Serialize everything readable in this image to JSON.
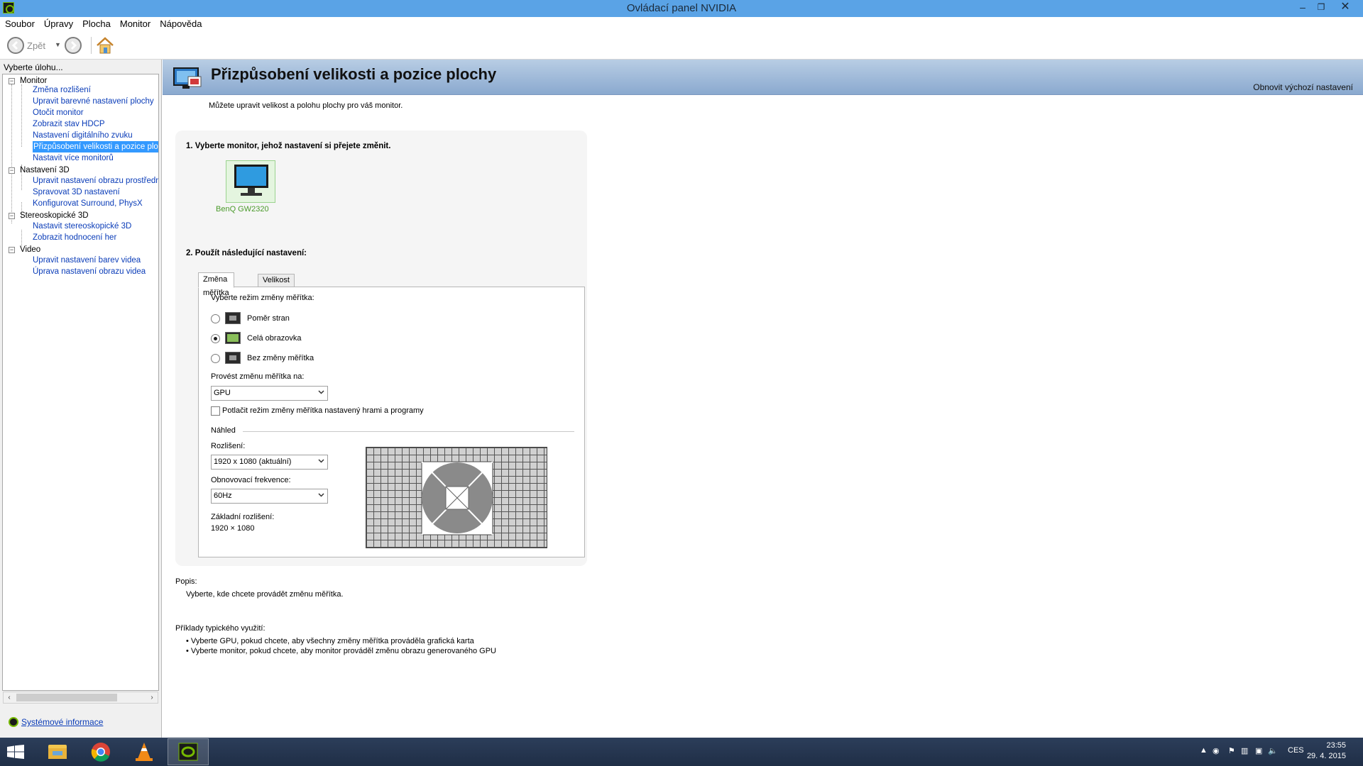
{
  "window": {
    "title": "Ovládací panel NVIDIA"
  },
  "menu": [
    "Soubor",
    "Úpravy",
    "Plocha",
    "Monitor",
    "Nápověda"
  ],
  "toolbar": {
    "back_label": "Zpět"
  },
  "left": {
    "header": "Vyberte úlohu...",
    "tree": {
      "monitor": "Monitor",
      "monitor_items": [
        "Změna rozlišení",
        "Upravit barevné nastavení plochy",
        "Otočit monitor",
        "Zobrazit stav HDCP",
        "Nastavení digitálního zvuku",
        "Přizpůsobení velikosti a pozice plochy",
        "Nastavit více monitorů"
      ],
      "settings3d": "Nastavení 3D",
      "settings3d_items": [
        "Upravit nastavení obrazu prostřednic",
        "Spravovat 3D nastavení",
        "Konfigurovat Surround, PhysX"
      ],
      "stereo": "Stereoskopické 3D",
      "stereo_items": [
        "Nastavit stereoskopické 3D",
        "Zobrazit hodnocení her"
      ],
      "video": "Video",
      "video_items": [
        "Upravit nastavení barev videa",
        "Úprava nastavení obrazu videa"
      ]
    },
    "sysinfo": "Systémové informace"
  },
  "page": {
    "heading": "Přizpůsobení velikosti a pozice plochy",
    "restore": "Obnovit výchozí nastavení",
    "intro": "Můžete upravit velikost a polohu plochy pro váš monitor.",
    "step1": "1. Vyberte monitor, jehož nastavení si přejete změnit.",
    "monitor_name": "BenQ GW2320",
    "step2": "2. Použít následující nastavení:",
    "tabs": [
      "Změna měřítka",
      "Velikost"
    ],
    "scaling_mode_label": "Vyberte režim změny měřítka:",
    "modes": [
      "Poměr stran",
      "Celá obrazovka",
      "Bez změny měřítka"
    ],
    "selected_mode": "Celá obrazovka",
    "perform_on_label": "Provést změnu měřítka na:",
    "perform_on_value": "GPU",
    "override_label": "Potlačit režim změny měřítka nastavený hrami a programy",
    "override_checked": false,
    "preview_label": "Náhled",
    "resolution_label": "Rozlišení:",
    "resolution_value": "1920 x 1080 (aktuální)",
    "refresh_label": "Obnovovací frekvence:",
    "refresh_value": "60Hz",
    "base_res_label": "Základní rozlišení:",
    "base_res_value": "1920 × 1080",
    "desc_label": "Popis:",
    "desc_text": "Vyberte, kde chcete provádět změnu měřítka.",
    "examples_label": "Příklady typického využití:",
    "examples": [
      "• Vyberte GPU, pokud chcete, aby všechny změny měřítka prováděla grafická karta",
      "• Vyberte monitor, pokud chcete, aby monitor prováděl změnu obrazu generovaného GPU"
    ]
  },
  "taskbar": {
    "lang": "CES",
    "time": "23:55",
    "date": "29. 4. 2015",
    "apps": [
      "file-explorer",
      "chrome",
      "vlc",
      "nvidia-control-panel"
    ]
  },
  "colors": {
    "titlebar": "#5aa3e6",
    "link": "#0a3cb8",
    "selection": "#3399ff",
    "nvidia_green": "#76b900"
  }
}
